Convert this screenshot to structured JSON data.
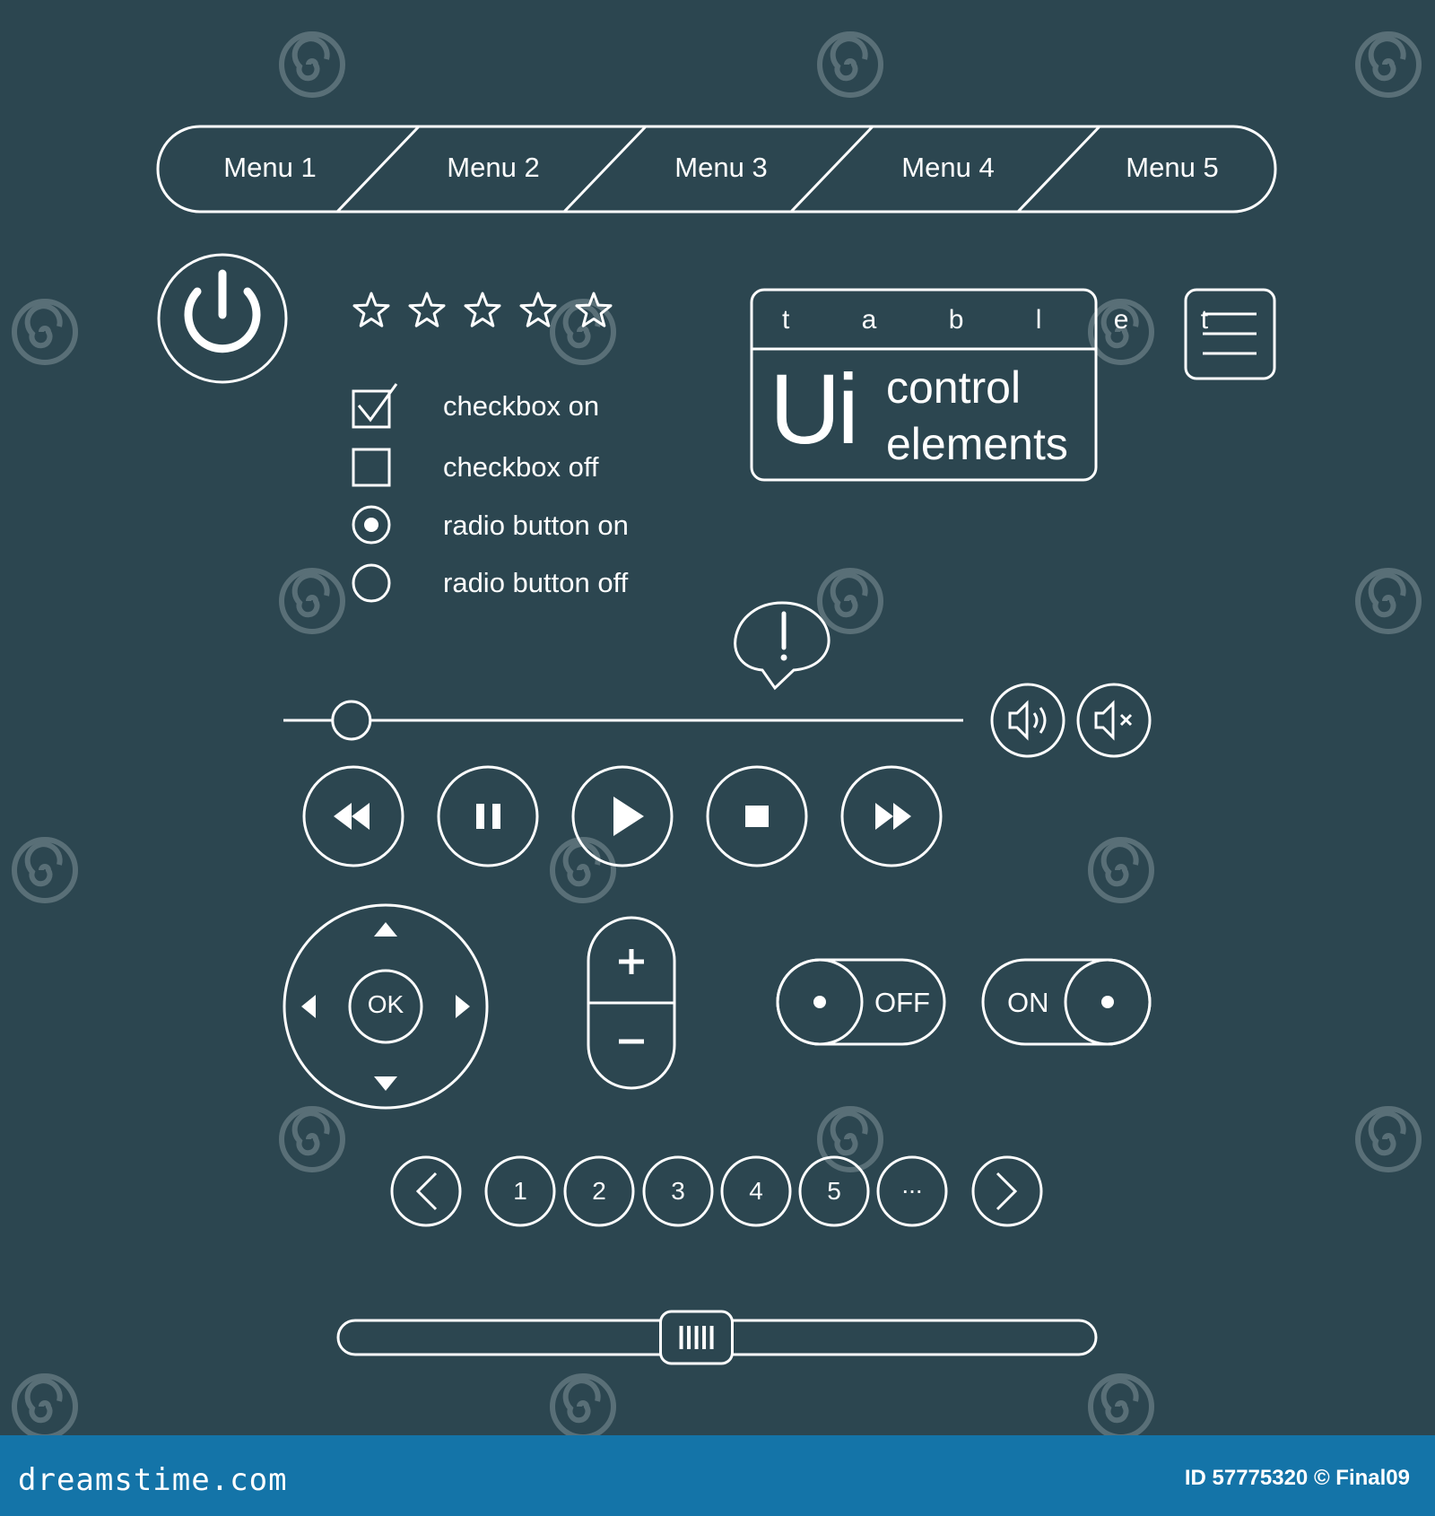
{
  "menu": {
    "items": [
      {
        "label": "Menu 1"
      },
      {
        "label": "Menu 2"
      },
      {
        "label": "Menu 3"
      },
      {
        "label": "Menu 4"
      },
      {
        "label": "Menu 5"
      }
    ]
  },
  "rating": {
    "stars_total": 5,
    "stars_filled": 0
  },
  "options": {
    "checkbox_on": "checkbox on",
    "checkbox_off": "checkbox off",
    "radio_on": "radio button on",
    "radio_off": "radio button off"
  },
  "title_card": {
    "top_word": "t a b l e t",
    "big_letters": "Ui",
    "line1": "control",
    "line2": "elements"
  },
  "alert": {
    "symbol": "!"
  },
  "seek_slider": {
    "value_fraction": 0.1
  },
  "media_controls": [
    "rewind",
    "pause",
    "play",
    "stop",
    "fast-forward"
  ],
  "dpad": {
    "center_label": "OK"
  },
  "zoom_stepper": {
    "plus": "+",
    "minus": "−"
  },
  "toggles": {
    "off_label": "OFF",
    "on_label": "ON"
  },
  "pagination": {
    "pages": [
      "1",
      "2",
      "3",
      "4",
      "5",
      "..."
    ]
  },
  "horizontal_scrollbar": {
    "thumb_fraction": 0.47
  },
  "watermark_text": "dreamstime",
  "footer": {
    "site": "dreamstime.com",
    "credit": "ID 57775320 © Final09"
  },
  "colors": {
    "background": "#2c4650",
    "stroke": "#ffffff",
    "footer_bar": "#1474a8"
  }
}
